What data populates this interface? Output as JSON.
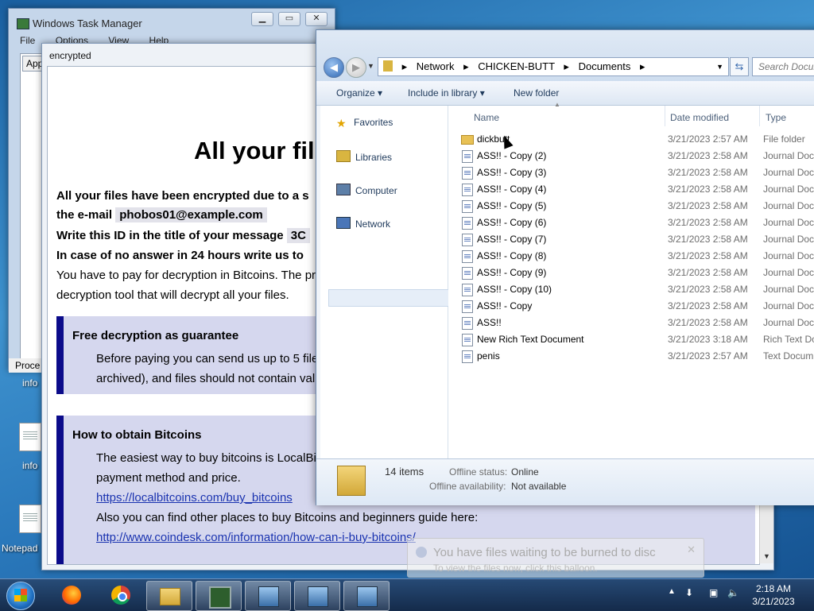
{
  "desktop": {
    "icons": [
      {
        "label": "info"
      },
      {
        "label": "info"
      },
      {
        "label": "Notepad"
      }
    ]
  },
  "task_manager": {
    "title": "Windows Task Manager",
    "menu": [
      "File",
      "Options",
      "View",
      "Help"
    ],
    "tab": "App",
    "bottom_tab": "Proce"
  },
  "ransom": {
    "window_title": "encrypted",
    "heading": "All your fil",
    "line1": "All your files have been encrypted due to a s",
    "email_prefix": "the e-mail",
    "email": "phobos01@example.com",
    "id_prefix": "Write this ID in the title of your message",
    "id_value": "3C",
    "line4": "In case of no answer in 24 hours write us to",
    "line5": "You have to pay for decryption in Bitcoins. The pr",
    "line6": "decryption tool that will decrypt all your files.",
    "box1": {
      "heading": "Free decryption as guarantee",
      "text1": "Before paying you can send us up to 5 file",
      "text2": "archived), and files should not contain valu"
    },
    "box2": {
      "heading": "How to obtain Bitcoins",
      "text1": "The easiest way to buy bitcoins is LocalBitc",
      "text2": "payment method and price.",
      "link1": "https://localbitcoins.com/buy_bitcoins",
      "text3": "Also you can find other places to buy Bitcoins and beginners guide here:",
      "link2": "http://www.coindesk.com/information/how-can-i-buy-bitcoins/"
    }
  },
  "explorer": {
    "breadcrumb": [
      "Network",
      "CHICKEN-BUTT",
      "Documents"
    ],
    "search_placeholder": "Search Docum",
    "toolbar": {
      "organize": "Organize",
      "include": "Include in library",
      "new_folder": "New folder"
    },
    "nav": [
      "Favorites",
      "Libraries",
      "Computer",
      "Network"
    ],
    "columns": {
      "name": "Name",
      "date": "Date modified",
      "type": "Type"
    },
    "files": [
      {
        "name": "dickbutt",
        "date": "3/21/2023 2:57 AM",
        "type": "File folder",
        "icon": "folder"
      },
      {
        "name": "ASS!! - Copy (2)",
        "date": "3/21/2023 2:58 AM",
        "type": "Journal Doc",
        "icon": "doc"
      },
      {
        "name": "ASS!! - Copy (3)",
        "date": "3/21/2023 2:58 AM",
        "type": "Journal Doc",
        "icon": "doc"
      },
      {
        "name": "ASS!! - Copy (4)",
        "date": "3/21/2023 2:58 AM",
        "type": "Journal Doc",
        "icon": "doc"
      },
      {
        "name": "ASS!! - Copy (5)",
        "date": "3/21/2023 2:58 AM",
        "type": "Journal Doc",
        "icon": "doc"
      },
      {
        "name": "ASS!! - Copy (6)",
        "date": "3/21/2023 2:58 AM",
        "type": "Journal Doc",
        "icon": "doc"
      },
      {
        "name": "ASS!! - Copy (7)",
        "date": "3/21/2023 2:58 AM",
        "type": "Journal Doc",
        "icon": "doc"
      },
      {
        "name": "ASS!! - Copy (8)",
        "date": "3/21/2023 2:58 AM",
        "type": "Journal Doc",
        "icon": "doc"
      },
      {
        "name": "ASS!! - Copy (9)",
        "date": "3/21/2023 2:58 AM",
        "type": "Journal Doc",
        "icon": "doc"
      },
      {
        "name": "ASS!! - Copy (10)",
        "date": "3/21/2023 2:58 AM",
        "type": "Journal Doc",
        "icon": "doc"
      },
      {
        "name": "ASS!! - Copy",
        "date": "3/21/2023 2:58 AM",
        "type": "Journal Doc",
        "icon": "doc"
      },
      {
        "name": "ASS!!",
        "date": "3/21/2023 2:58 AM",
        "type": "Journal Doc",
        "icon": "doc"
      },
      {
        "name": "New Rich Text Document",
        "date": "3/21/2023 3:18 AM",
        "type": "Rich Text Do",
        "icon": "doc"
      },
      {
        "name": "penis",
        "date": "3/21/2023 2:57 AM",
        "type": "Text Docum",
        "icon": "doc"
      }
    ],
    "details": {
      "count": "14 items",
      "offline_status_label": "Offline status:",
      "offline_status": "Online",
      "offline_avail_label": "Offline availability:",
      "offline_avail": "Not available"
    }
  },
  "balloon": {
    "title": "You have files waiting to be burned to disc",
    "text": "To view the files now, click this balloon."
  },
  "taskbar": {
    "time": "2:18 AM",
    "date": "3/21/2023"
  }
}
